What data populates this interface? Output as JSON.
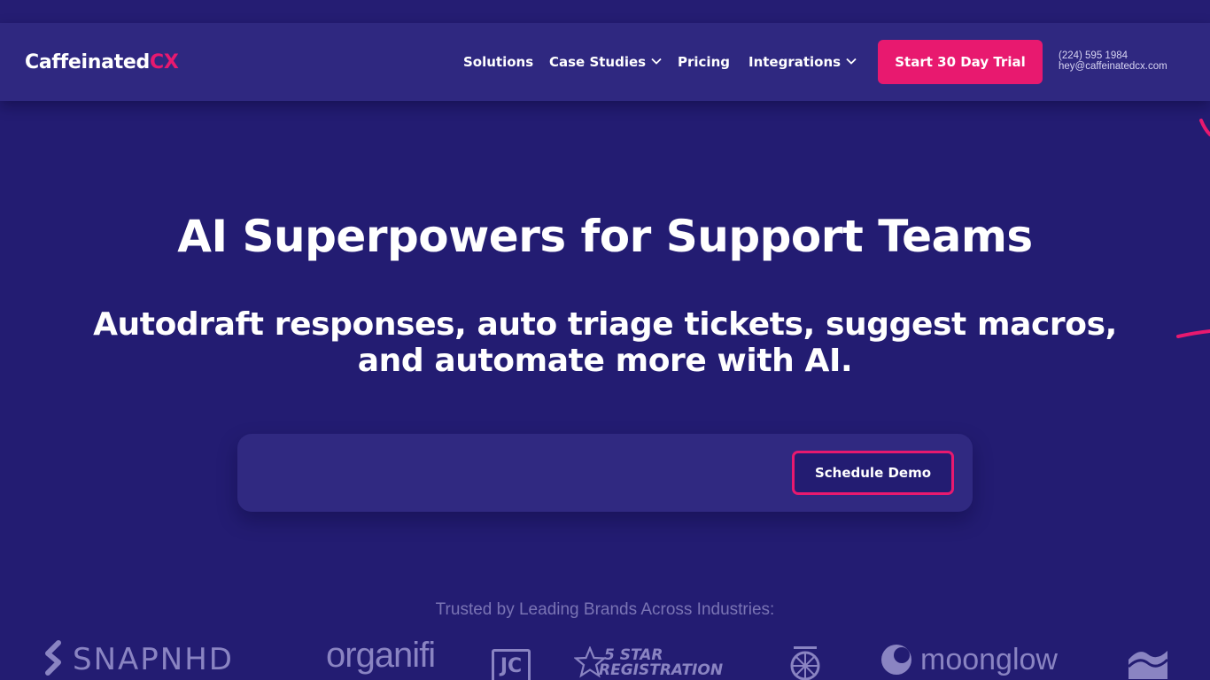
{
  "header": {
    "logo": {
      "text": "Caffeinated",
      "accent": "CX"
    },
    "nav": [
      {
        "label": "Solutions",
        "has_dropdown": false
      },
      {
        "label": "Case Studies",
        "has_dropdown": true
      },
      {
        "label": "Pricing",
        "has_dropdown": false
      },
      {
        "label": "Integrations",
        "has_dropdown": true
      }
    ],
    "cta_label": "Start 30 Day Trial",
    "contact": {
      "phone": "(224) 595 1984",
      "email": "hey@caffeinatedcx.com"
    }
  },
  "hero": {
    "title": "AI Superpowers for Support Teams",
    "subtitle_line1": "Autodraft responses, auto triage tickets, suggest macros,",
    "subtitle_line2": "and automate more with AI.",
    "demo_button_label": "Schedule Demo"
  },
  "trusted": {
    "heading": "Trusted by Leading Brands Across Industries:",
    "brands": [
      "SNAPNHD",
      "organifi",
      "JC",
      "5 STAR",
      "REGISTRATION",
      "moonglow"
    ]
  },
  "colors": {
    "background": "#231c72",
    "navbar": "#2f2880",
    "accent": "#e8196f",
    "muted_text": "#7a74b4"
  },
  "icons": [
    "chevron-down-icon",
    "snapnhd-logo-icon",
    "star-logo-icon",
    "emblem-logo-icon",
    "moonglow-logo-icon",
    "wave-logo-icon"
  ]
}
